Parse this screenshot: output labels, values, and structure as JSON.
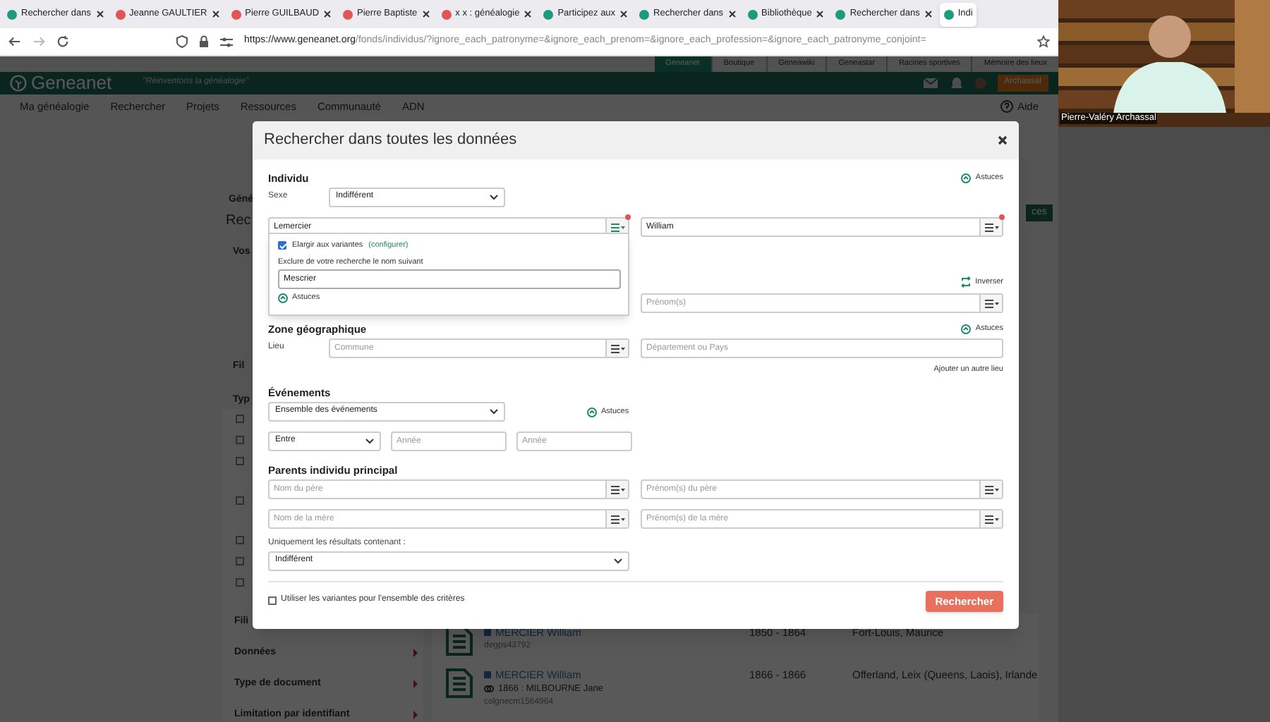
{
  "browser": {
    "tabs": [
      {
        "label": "Rechercher dans",
        "selected": false,
        "color": "#1f9a7c"
      },
      {
        "label": "Jeanne GAULTIER",
        "selected": false,
        "color": "#e05555"
      },
      {
        "label": "Pierre GUILBAUD",
        "selected": false,
        "color": "#e05555"
      },
      {
        "label": "Pierre Baptiste",
        "selected": false,
        "color": "#e05555"
      },
      {
        "label": "x x : généalogie",
        "selected": false,
        "color": "#e05555"
      },
      {
        "label": "Participez aux",
        "selected": false,
        "color": "#1f9a7c"
      },
      {
        "label": "Rechercher dans",
        "selected": false,
        "color": "#1f9a7c"
      },
      {
        "label": "Bibliothèque",
        "selected": false,
        "color": "#1f9a7c"
      },
      {
        "label": "Rechercher dans",
        "selected": false,
        "color": "#1f9a7c"
      },
      {
        "label": "Indi",
        "selected": true,
        "color": "#1f9a7c"
      }
    ],
    "url_host": "https://www.geneanet.org",
    "url_path": "/fonds/individus/?ignore_each_patronyme=&ignore_each_prenom=&ignore_each_profession=&ignore_each_patronyme_conjoint="
  },
  "site": {
    "top_links": [
      {
        "label": "Geneanet",
        "selected": true
      },
      {
        "label": "Boutique",
        "selected": false
      },
      {
        "label": "Geneawiki",
        "selected": false
      },
      {
        "label": "Geneastar",
        "selected": false
      },
      {
        "label": "Racines sportives",
        "selected": false
      },
      {
        "label": "Mémoire des lieux",
        "selected": false
      }
    ],
    "logo": "Geneanet",
    "tagline": "\"Réinventons la généalogie\"",
    "user": "Archassal",
    "nav": [
      "Ma généalogie",
      "Rechercher",
      "Projets",
      "Ressources",
      "Communauté",
      "ADN"
    ],
    "help": "Aide"
  },
  "sidebar": {
    "fragments": [
      "Géné",
      "Rec",
      "Vos",
      "Fil",
      "Typ"
    ],
    "checkboxes": [
      {
        "checked": false
      },
      {
        "checked": false
      },
      {
        "checked": false
      },
      {
        "checked": false
      },
      {
        "checked": false
      },
      {
        "checked": false
      },
      {
        "checked": false
      }
    ],
    "sections": [
      "Fili",
      "Données",
      "Type de document",
      "Limitation par identifiant"
    ]
  },
  "results": [
    {
      "name": "MERCIER William",
      "ref": "degps43792",
      "years": "1850 - 1864",
      "place": "Fort-Louis, Maurice"
    },
    {
      "name": "MERCIER William",
      "spouse": "1866 : MILBOURNE Jane",
      "ref": "colgnecm1564964",
      "years": "1866 - 1866",
      "place": "Offerland, Leix (Queens, Laois), Irlande"
    }
  ],
  "right_fragments": {
    "button": "ces"
  },
  "modal": {
    "title": "Rechercher dans toutes les données",
    "individu": {
      "heading": "Individu",
      "tips": "Astuces",
      "sex_label": "Sexe",
      "sex": {
        "value": "Indifférent"
      },
      "surname": {
        "value": "Lemercier",
        "indicator": true,
        "open": true
      },
      "first_name": {
        "value": "William",
        "indicator": true,
        "open": false
      },
      "swap": "Inverser",
      "first_name_2": {
        "placeholder": "Prénom(s)",
        "indicator": false,
        "open": false
      }
    },
    "variants_popover": {
      "checked": true,
      "label": "Elargir aux variantes",
      "link": "(configurer)",
      "exclude_label": "Exclure de votre recherche le nom suivant",
      "exclude_value": "Mescrier",
      "tips": "Astuces"
    },
    "zone": {
      "heading": "Zone géographique",
      "tips": "Astuces",
      "place_label": "Lieu",
      "town": {
        "placeholder": "Commune",
        "indicator": false,
        "open": false
      },
      "region": {
        "placeholder": "Département ou Pays"
      },
      "add_place": "Ajouter un autre lieu"
    },
    "events": {
      "heading": "Événements",
      "type": {
        "value": "Ensemble des événements"
      },
      "tips": "Astuces",
      "range": {
        "value": "Entre"
      },
      "year_from": {
        "placeholder": "Année"
      },
      "year_to": {
        "placeholder": "Année"
      }
    },
    "parents": {
      "heading": "Parents individu principal",
      "fields": [
        {
          "placeholder": "Nom du père",
          "indicator": false,
          "open": false
        },
        {
          "placeholder": "Prénom(s) du père",
          "indicator": false,
          "open": false
        },
        {
          "placeholder": "Nom de la mère",
          "indicator": false,
          "open": false
        },
        {
          "placeholder": "Prénom(s) de la mère",
          "indicator": false,
          "open": false
        }
      ]
    },
    "only_results_label": "Uniquement les résultats contenant :",
    "only_results": {
      "value": "Indifférent"
    },
    "use_variants": {
      "checked": false,
      "label": "Utiliser les variantes pour l'ensemble des critères"
    },
    "search_button": "Rechercher"
  },
  "video": {
    "kind": "picture",
    "caption": "Pierre-Valéry Archassal"
  }
}
